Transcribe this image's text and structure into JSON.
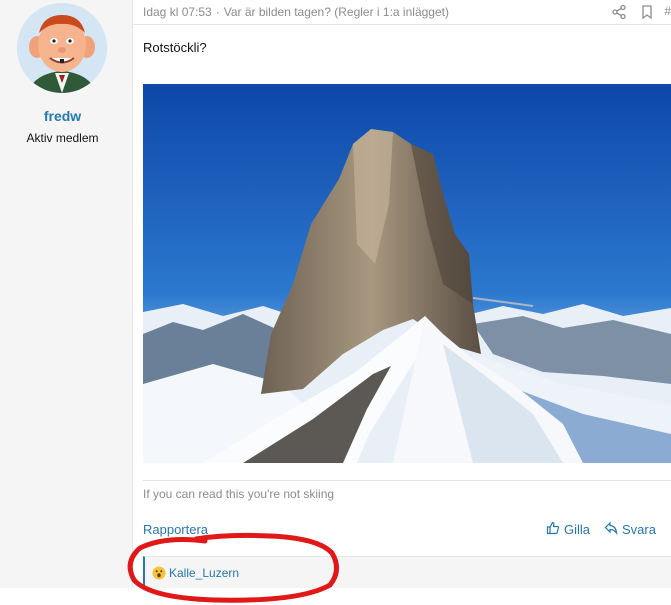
{
  "user": {
    "name": "fredw",
    "title": "Aktiv medlem"
  },
  "post": {
    "time": "Idag kl 07:53",
    "separator": "·",
    "thread_title": "Var är bilden tagen? (Regler i 1:a inlägget)",
    "hash": "#",
    "text": "Rotstöckli?",
    "signature": "If you can read this you're not skiing"
  },
  "actions": {
    "report": "Rapportera",
    "like": "Gilla",
    "reply": "Svara"
  },
  "reactions": {
    "user": "Kalle_Luzern",
    "emoji": "wow-emoji-icon"
  },
  "colors": {
    "link": "#2577b1",
    "muted": "#8c8c8c",
    "annotation": "#e01818"
  }
}
